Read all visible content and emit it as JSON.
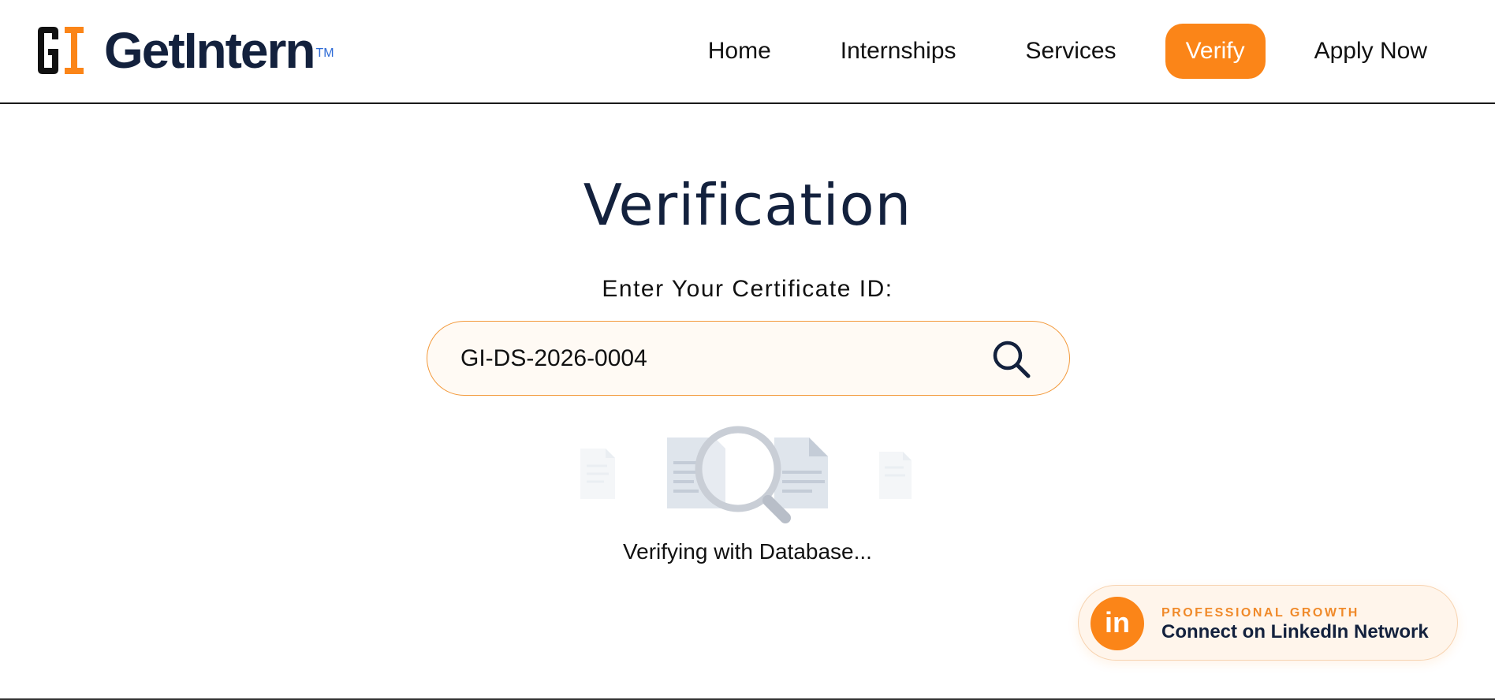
{
  "brand": {
    "name": "GetIntern",
    "trademark": "TM",
    "mark_letters": [
      "G",
      "I"
    ],
    "colors": {
      "dark": "#13213d",
      "accent": "#fb8518",
      "black": "#111111"
    }
  },
  "nav": {
    "items": [
      {
        "label": "Home",
        "active": false
      },
      {
        "label": "Internships",
        "active": false
      },
      {
        "label": "Services",
        "active": false
      },
      {
        "label": "Verify",
        "active": true
      },
      {
        "label": "Apply Now",
        "active": false
      }
    ]
  },
  "main": {
    "title": "Verification",
    "field_label": "Enter Your Certificate ID:",
    "certificate_input": {
      "value": "GI-DS-2026-0004"
    },
    "search_icon": "search-icon",
    "status": "Verifying with Database..."
  },
  "linkedin": {
    "icon_text": "in",
    "eyebrow": "PROFESSIONAL GROWTH",
    "title": "Connect on LinkedIn Network"
  }
}
